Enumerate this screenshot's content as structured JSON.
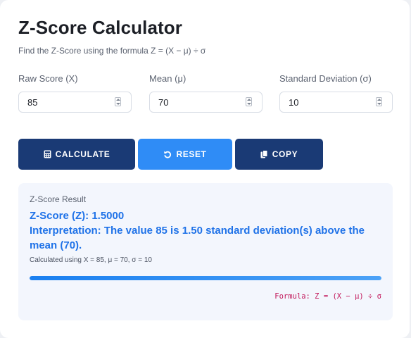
{
  "header": {
    "title": "Z-Score Calculator",
    "subtitle": "Find the Z-Score using the formula Z = (X − μ) ÷ σ"
  },
  "inputs": [
    {
      "label": "Raw Score (X)",
      "value": "85"
    },
    {
      "label": "Mean (μ)",
      "value": "70"
    },
    {
      "label": "Standard Deviation (σ)",
      "value": "10"
    }
  ],
  "buttons": {
    "calculate": {
      "label": "CALCULATE",
      "icon": "calculator-icon",
      "color": "#1a3a75"
    },
    "reset": {
      "label": "RESET",
      "icon": "undo-icon",
      "color": "#2f8cf6"
    },
    "copy": {
      "label": "COPY",
      "icon": "copy-icon",
      "color": "#1a3a75"
    }
  },
  "result": {
    "heading": "Z-Score Result",
    "zscore_line": "Z-Score (Z): 1.5000",
    "interpretation": "Interpretation: The value 85 is 1.50 standard deviation(s) above the mean (70).",
    "calc_note": "Calculated using X = 85, μ = 70, σ = 10",
    "progress_fraction": 1.0,
    "formula": "Formula: Z = (X − μ) ÷ σ",
    "accent_color": "#1f72e8",
    "formula_color": "#c2185b"
  }
}
